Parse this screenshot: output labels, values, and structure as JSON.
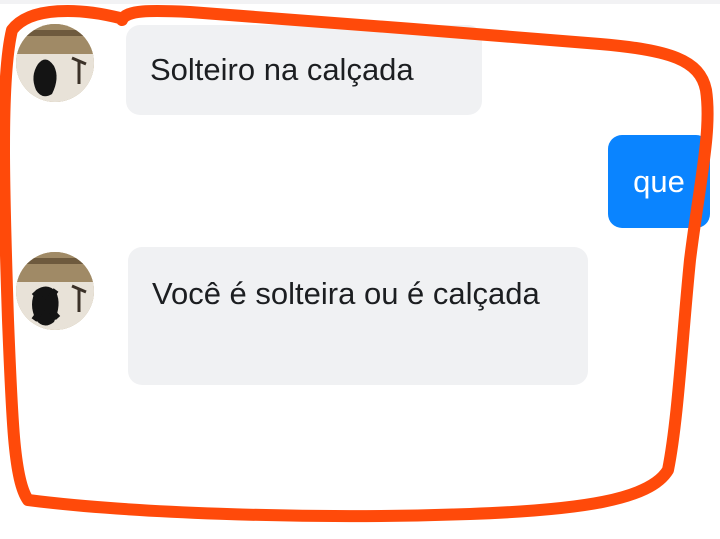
{
  "conversation": {
    "messages": [
      {
        "sender": "contact",
        "text": "Solteiro na calçada"
      },
      {
        "sender": "self",
        "text": "que"
      },
      {
        "sender": "contact",
        "text": "Você é solteira ou é calçada"
      }
    ]
  },
  "colors": {
    "incoming_bubble": "#f0f1f3",
    "outgoing_bubble": "#0a84ff",
    "highlight_marker": "#ff4a0a"
  }
}
